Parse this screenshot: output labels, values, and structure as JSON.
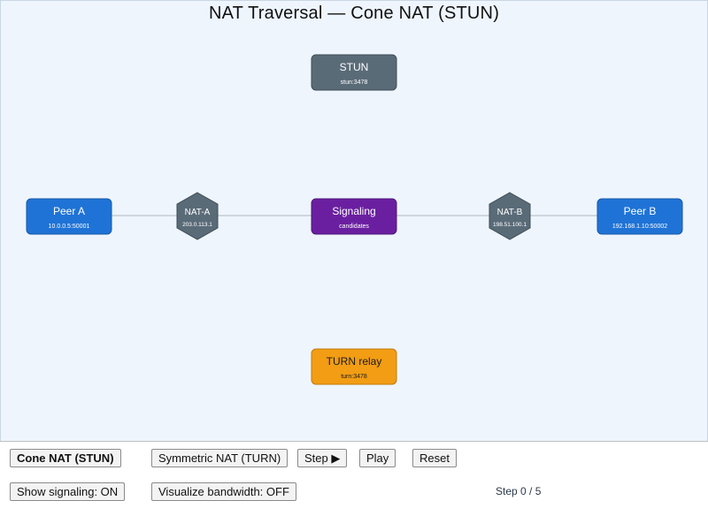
{
  "title": "NAT Traversal — Cone NAT (STUN)",
  "colors": {
    "stage_bg": "#eef5fc",
    "peer": "#1f73d6",
    "nat": "#5a6b78",
    "stun": "#5a6b78",
    "signaling": "#6a1fa0",
    "turn": "#f29d14",
    "link": "#c4ccd4"
  },
  "nodes": {
    "stun": {
      "label": "STUN",
      "sub": "stun:3478"
    },
    "peer_a": {
      "label": "Peer A",
      "sub": "10.0.0.5:50001"
    },
    "nat_a": {
      "label": "NAT-A",
      "sub": "203.0.113.1"
    },
    "signaling": {
      "label": "Signaling",
      "sub": "candidates"
    },
    "nat_b": {
      "label": "NAT-B",
      "sub": "198.51.100.1"
    },
    "peer_b": {
      "label": "Peer B",
      "sub": "192.168.1.10:50002"
    },
    "turn": {
      "label": "TURN relay",
      "sub": "turn:3478"
    }
  },
  "controls": {
    "cone": "Cone NAT (STUN)",
    "symmetric": "Symmetric NAT (TURN)",
    "step": "Step ▶",
    "play": "Play",
    "reset": "Reset",
    "signaling_toggle": "Show signaling: ON",
    "bandwidth_toggle": "Visualize bandwidth: OFF",
    "step_status": "Step 0 / 5"
  }
}
